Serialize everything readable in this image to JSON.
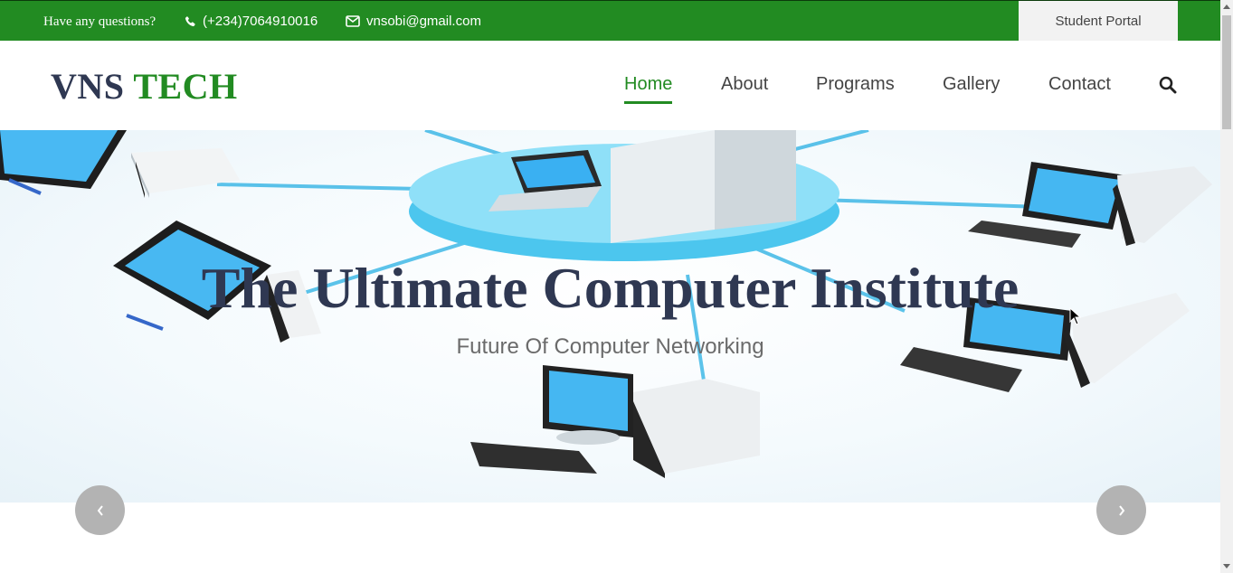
{
  "topbar": {
    "question": "Have any questions?",
    "phone": "(+234)7064910016",
    "email": "vnsobi@gmail.com",
    "portal": "Student Portal",
    "bg_color": "#228b22"
  },
  "logo": {
    "part1": "VNS",
    "part2": "TECH"
  },
  "nav": [
    {
      "label": "Home",
      "active": true
    },
    {
      "label": "About",
      "active": false
    },
    {
      "label": "Programs",
      "active": false
    },
    {
      "label": "Gallery",
      "active": false
    },
    {
      "label": "Contact",
      "active": false
    }
  ],
  "icons": {
    "search": "search-icon",
    "phone": "phone-icon",
    "email": "envelope-icon",
    "prev": "chevron-left-icon",
    "next": "chevron-right-icon"
  },
  "hero": {
    "title": "The Ultimate Computer Institute",
    "subtitle": "Future Of Computer Networking"
  },
  "colors": {
    "accent": "#228b22",
    "brand_dark": "#2f3852"
  }
}
